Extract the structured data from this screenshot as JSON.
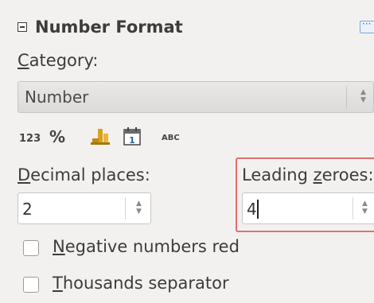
{
  "panel": {
    "title": "Number Format",
    "category_label_u": "C",
    "category_label_rest": "ategory:",
    "category_value": "Number"
  },
  "toolbar": {
    "items": [
      {
        "name": "number-format",
        "text": "123"
      },
      {
        "name": "percent-format",
        "text": "%"
      },
      {
        "name": "currency-format",
        "text": ""
      },
      {
        "name": "date-format",
        "text": "1"
      },
      {
        "name": "text-format",
        "text": "ABC"
      }
    ]
  },
  "decimal": {
    "label_u": "D",
    "label_rest": "ecimal places:",
    "value": "2"
  },
  "leading": {
    "label_pre": "Leading ",
    "label_u": "z",
    "label_rest": "eroes:",
    "value": "4"
  },
  "checkboxes": {
    "negative": {
      "u": "N",
      "rest": "egative numbers red",
      "checked": false
    },
    "thousands": {
      "u": "T",
      "rest": "housands separator",
      "checked": false
    }
  },
  "colors": {
    "highlight": "#e07070",
    "currency_icon": "#d9a21e"
  }
}
